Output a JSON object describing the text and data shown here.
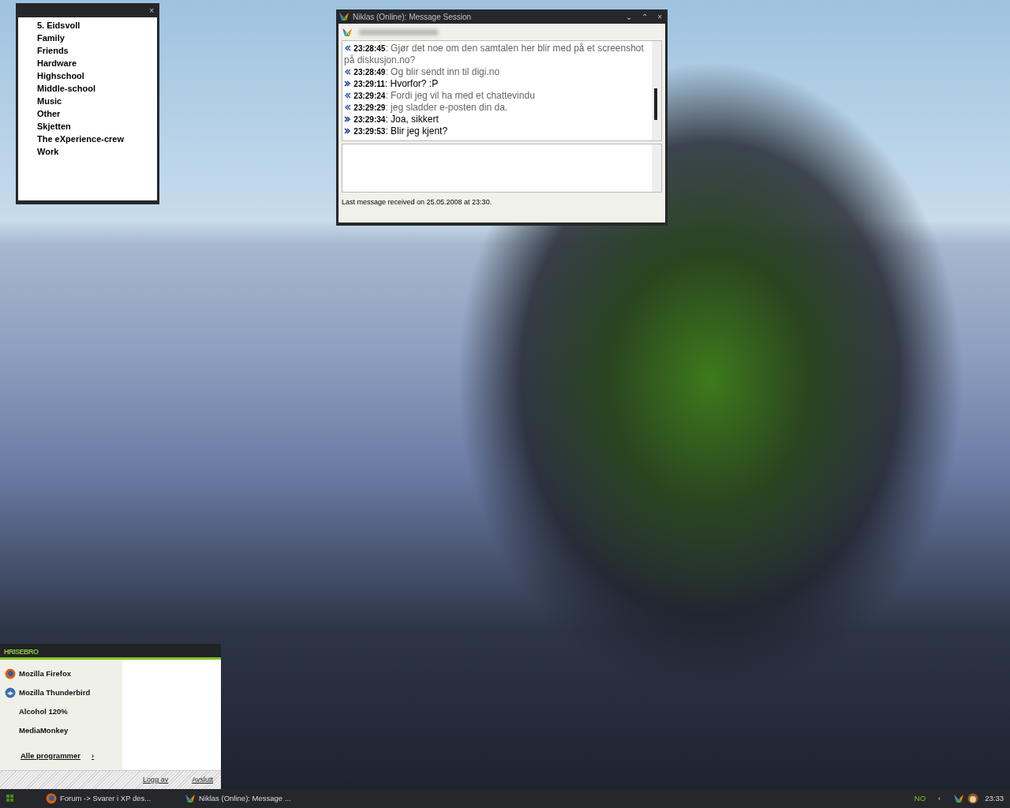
{
  "groups_window": {
    "close": "×",
    "items": [
      "5. Eidsvoll",
      "Family",
      "Friends",
      "Hardware",
      "Highschool",
      "Middle-school",
      "Music",
      "Other",
      "Skjetten",
      "The eXperience-crew",
      "Work"
    ]
  },
  "chat_window": {
    "title": "Niklas (Online): Message Session",
    "controls": [
      "⌄",
      "⌃",
      "×"
    ],
    "messages": [
      {
        "kind": "received",
        "text": "**23:28:45**: Gjør det noe om den samtalen her blir med på et screenshot på diskusjon.no?"
      },
      {
        "kind": "received",
        "text": "**23:28:49**: Og blir sendt inn til digi.no"
      },
      {
        "kind": "sent",
        "text": "**23:29:11**: Hvorfor? :P"
      },
      {
        "kind": "received",
        "text": "**23:29:24**: Fordi jeg vil ha med et chattevindu"
      },
      {
        "kind": "received",
        "text": "**23:29:29**: jeg sladder e-posten din da."
      },
      {
        "kind": "sent",
        "text": "**23:29:34**: Joa, sikkert"
      },
      {
        "kind": "sent",
        "text": "**23:29:53**: Blir jeg kjent?"
      }
    ],
    "status": "Last message received on 25.05.2008 at 23:30."
  },
  "start_menu": {
    "user": "HRISEBRO",
    "programs": [
      "Mozilla Firefox",
      "Mozilla Thunderbird",
      "Alcohol 120%",
      "MediaMonkey"
    ],
    "all_programs": {
      "label": "Alle programmer",
      "arrow": "›"
    },
    "footer": [
      "Logg av",
      "Avslutt"
    ]
  },
  "taskbar": {
    "tasks": [
      "Forum -> Svarer i XP des...",
      "Niklas (Online): Message ..."
    ],
    "language": "NO",
    "tray_arrow": "‹",
    "clock": "23:33"
  }
}
